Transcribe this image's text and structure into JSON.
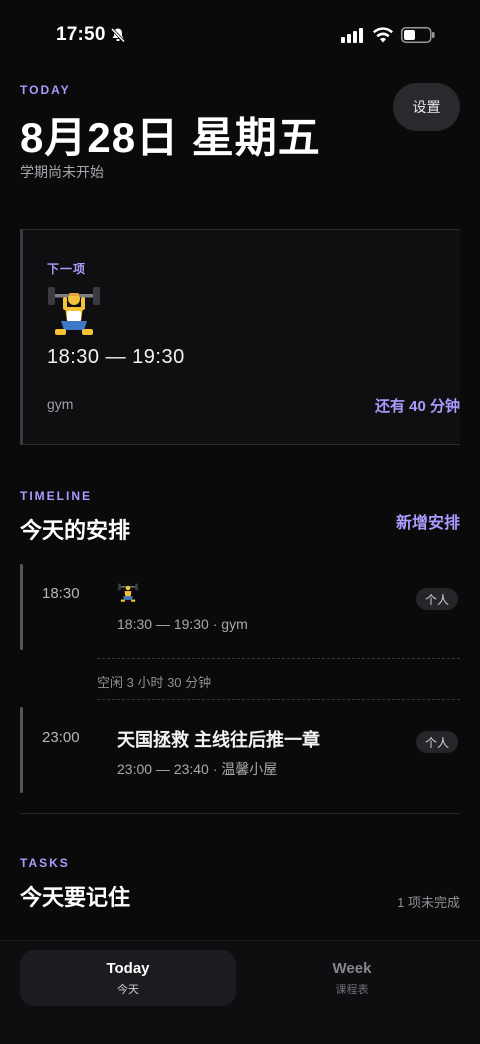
{
  "status_bar": {
    "time": "17:50"
  },
  "header": {
    "eyebrow": "TODAY",
    "title": "8月28日 星期五",
    "subtitle": "学期尚未开始",
    "settings_label": "设置"
  },
  "next_item": {
    "label": "下一项",
    "time": "18:30 — 19:30",
    "place": "gym",
    "remaining": "还有 40 分钟"
  },
  "timeline": {
    "eyebrow": "TIMELINE",
    "title": "今天的安排",
    "new_label": "新增安排",
    "events": [
      {
        "start": "18:30",
        "title": "",
        "meta": "18:30 — 19:30 · gym",
        "tag": "个人"
      },
      {
        "start": "23:00",
        "title": "天国拯救 主线往后推一章",
        "meta": "23:00 — 23:40 · 温馨小屋",
        "tag": "个人"
      }
    ],
    "free_text": "空闲 3 小时 30 分钟"
  },
  "tasks": {
    "eyebrow": "TASKS",
    "title": "今天要记住",
    "note": "1 项未完成"
  },
  "tabbar": {
    "tabs": [
      {
        "label": "Today",
        "sub": "今天",
        "active": true
      },
      {
        "label": "Week",
        "sub": "课程表",
        "active": false
      }
    ]
  },
  "colors": {
    "accent": "#a99cff",
    "background": "#0a0a0b"
  },
  "icons": [
    "bell-slash-icon",
    "cellular-signal-icon",
    "wifi-icon",
    "battery-icon",
    "weightlifter-icon"
  ]
}
